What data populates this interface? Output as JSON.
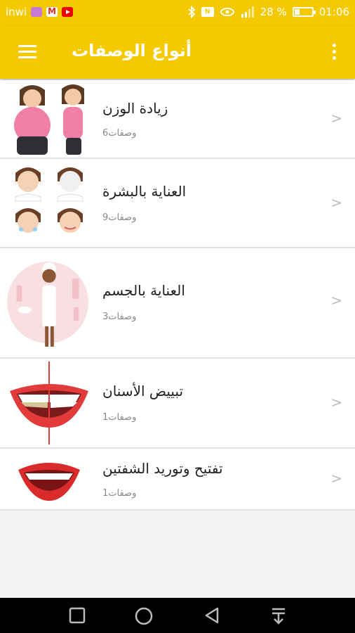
{
  "status_bar": {
    "carrier": "inwi",
    "battery_text": "28 %",
    "battery_level": 0.28,
    "time": "01:06",
    "icons": [
      "gallery-icon",
      "gmail-icon",
      "youtube-icon",
      "bluetooth-icon",
      "nfc-icon",
      "eye-icon",
      "signal-icon",
      "battery-icon"
    ]
  },
  "app_bar": {
    "title": "أنواع الوصفات",
    "color": "#f4c900"
  },
  "categories": [
    {
      "title": "زيادة الوزن",
      "count": "6وصفات",
      "chevron": ">"
    },
    {
      "title": "العناية بالبشرة",
      "count": "9وصفات",
      "chevron": ">"
    },
    {
      "title": "العناية بالجسم",
      "count": "3وصفات",
      "chevron": ">"
    },
    {
      "title": "تبييض الأسنان",
      "count": "1وصفات",
      "chevron": ">"
    },
    {
      "title": "تفتيح وتوريد الشفتين",
      "count": "1وصفات",
      "chevron": ">"
    }
  ]
}
